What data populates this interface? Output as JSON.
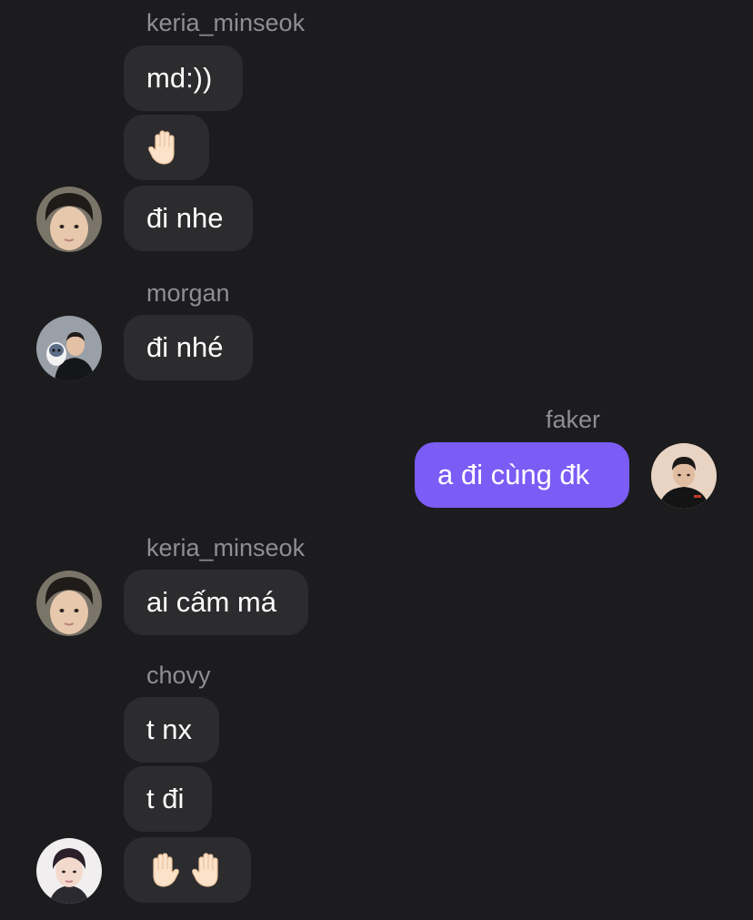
{
  "messages": [
    {
      "sender": "keria_minseok",
      "texts": [
        "md:))",
        "",
        "đi nhe"
      ]
    },
    {
      "sender": "morgan",
      "texts": [
        "đi nhé"
      ]
    },
    {
      "sender": "faker",
      "texts": [
        "a đi cùng đk"
      ]
    },
    {
      "sender": "keria_minseok",
      "texts": [
        "ai cấm má"
      ]
    },
    {
      "sender": "chovy",
      "texts": [
        "t nx",
        "t đi",
        ""
      ]
    }
  ],
  "emoji": {
    "raised_hand": "raised-hand-icon"
  },
  "colors": {
    "background": "#1c1c1e",
    "incoming_bubble": "#2c2c2e",
    "outgoing_bubble": "#7b5cf5",
    "sender_name": "#8e8e93",
    "text": "#ffffff"
  }
}
